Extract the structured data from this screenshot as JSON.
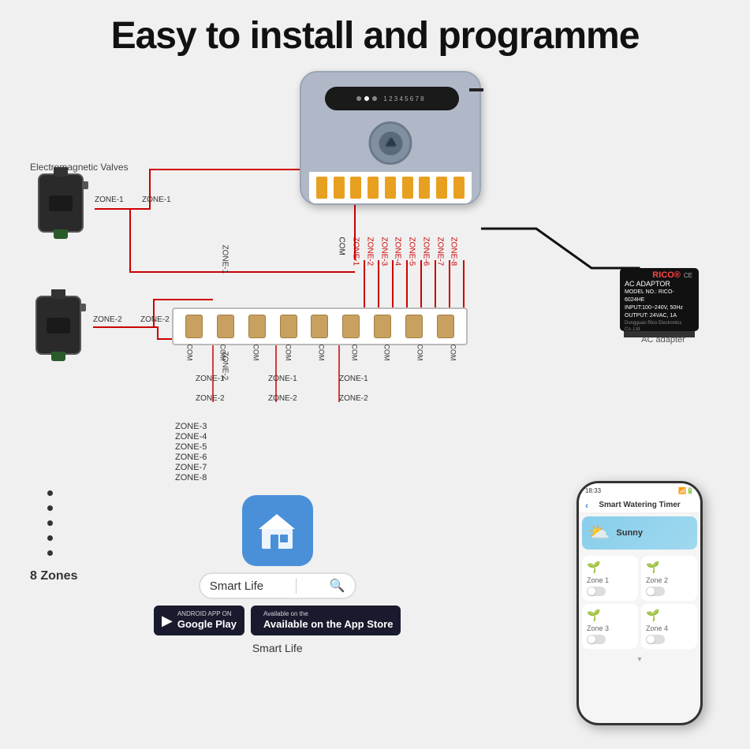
{
  "title": "Easy to install and  programme",
  "em_valves_label": "Electromagnetic Valves",
  "valve1": {
    "zones": [
      "ZONE-1",
      "ZONE-1"
    ]
  },
  "valve2": {
    "zones": [
      "ZONE-2",
      "ZONE-2"
    ]
  },
  "zone_list": [
    "ZONE-3",
    "ZONE-4",
    "ZONE-5",
    "ZONE-6",
    "ZONE-7",
    "ZONE-8"
  ],
  "zones_count": "8 Zones",
  "dots": 5,
  "wiring": {
    "zone_labels_bottom": [
      "ZONE-1",
      "ZONE-1",
      "ZONE-1"
    ],
    "zone_labels_bottom2": [
      "ZONE-2",
      "ZONE-2",
      "ZONE-2"
    ],
    "com_labels": [
      "COM",
      "COM",
      "COM",
      "COM",
      "COM",
      "COM",
      "COM",
      "COM",
      "COM"
    ]
  },
  "ac_adapter": {
    "brand": "RICO®",
    "label": "AC ADAPTOR",
    "model": "MODEL NO.: RICO-6024HE",
    "input": "INPUT:100~240V, 50Hz",
    "output": "OUTPUT: 24VAC, 1A",
    "company": "Dongguan Rico Electronics Co.,Ltd",
    "caption": "AC adapter"
  },
  "smart_life": {
    "app_name": "Smart Life",
    "search_placeholder": "Smart Life",
    "google_play_label": "ANDROID APP ON\nGoogle Play",
    "app_store_label": "Available on the\nApp Store"
  },
  "phone": {
    "time": "18:33",
    "title": "Smart Watering Timer",
    "weather": "Sunny",
    "zones": [
      {
        "label": "Zone 1"
      },
      {
        "label": "Zone 2"
      },
      {
        "label": "Zone 3"
      },
      {
        "label": "Zone 4"
      }
    ]
  },
  "controller": {
    "dots": [
      "",
      "",
      "",
      "",
      "",
      "",
      "",
      "",
      "",
      "",
      "",
      ""
    ],
    "terminals": 9
  }
}
